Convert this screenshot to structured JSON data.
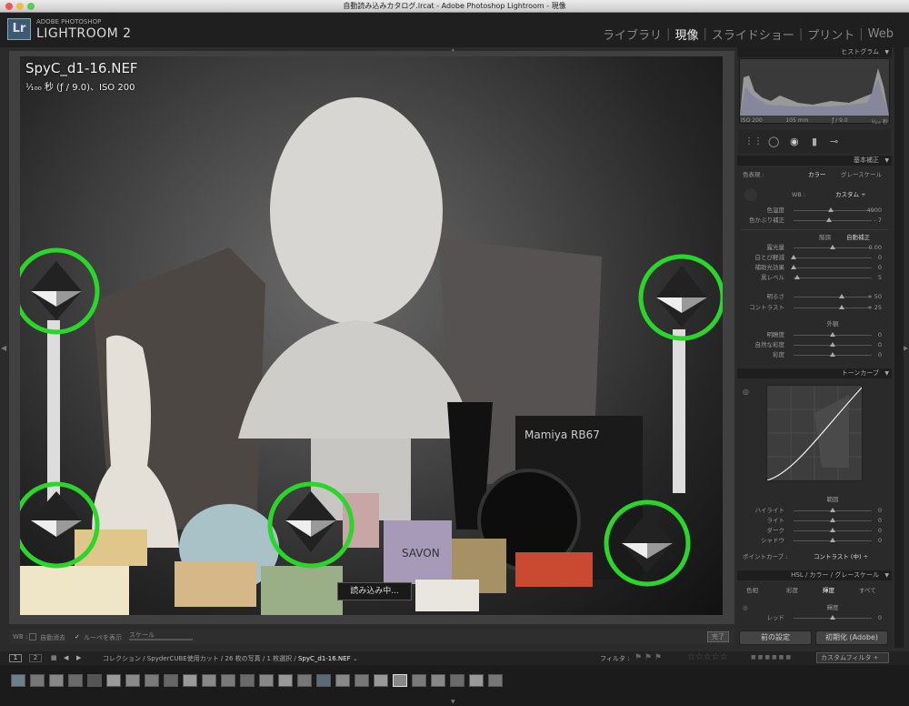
{
  "window": {
    "title": "自動読み込みカタログ.lrcat - Adobe Photoshop Lightroom - 現像"
  },
  "brand": {
    "small": "ADOBE PHOTOSHOP",
    "big": "LIGHTROOM 2",
    "badge": "Lr"
  },
  "modules": [
    "ライブラリ",
    "現像",
    "スライドショー",
    "プリント",
    "Web"
  ],
  "modules_active": "現像",
  "photo": {
    "filename": "SpyC_d1-16.NEF",
    "info": "¹⁄₁₀₀ 秒 (ƒ / 9.0)、ISO 200",
    "loading": "読み込み中...",
    "camera_label": "Mamiya RB67",
    "soap_label": "SAVON"
  },
  "toolbar": {
    "wb": "WB :",
    "auto_dismiss": "自動消去",
    "show_loupe": "ルーペを表示",
    "scale": "スケール",
    "done": "完了"
  },
  "panels": {
    "histogram": "ヒストグラム",
    "hist_info": [
      "ISO 200",
      "105 mm",
      "ƒ / 9.0",
      "¹⁄₁₀₀ 秒"
    ],
    "basic": "基本補正",
    "treatment_label": "色表現 :",
    "treatment_color": "カラー",
    "treatment_gray": "グレースケール",
    "wb_label": "WB :",
    "wb_value": "カスタム ÷",
    "tone_header": "階調",
    "auto_tone": "自動補正",
    "presence_header": "外観",
    "tonecurve": "トーンカーブ",
    "region": "範囲",
    "point_curve_label": "ポイントカーブ :",
    "point_curve_value": "コントラスト (中) ÷",
    "hsl": "HSL / カラー / グレースケール",
    "hsl_tabs": [
      "色相",
      "彩度",
      "輝度",
      "すべて"
    ],
    "luminance": "輝度",
    "red": "レッド",
    "red_value": "0"
  },
  "sliders_wb": [
    {
      "label": "色温度",
      "value": "4900",
      "pos": 0.48
    },
    {
      "label": "色かぶり補正",
      "value": "- 7",
      "pos": 0.45
    }
  ],
  "sliders_tone": [
    {
      "label": "露光量",
      "value": "0.00",
      "pos": 0.5
    },
    {
      "label": "白とび軽減",
      "value": "0",
      "pos": 0.0
    },
    {
      "label": "補助光効果",
      "value": "0",
      "pos": 0.0
    },
    {
      "label": "黒レベル",
      "value": "5",
      "pos": 0.05
    },
    {
      "label": "明るさ",
      "value": "+ 50",
      "pos": 0.62
    },
    {
      "label": "コントラスト",
      "value": "+ 25",
      "pos": 0.62
    }
  ],
  "sliders_presence": [
    {
      "label": "明瞭度",
      "value": "0",
      "pos": 0.5
    },
    {
      "label": "自然な彩度",
      "value": "0",
      "pos": 0.5
    },
    {
      "label": "彩度",
      "value": "0",
      "pos": 0.5
    }
  ],
  "sliders_region": [
    {
      "label": "ハイライト",
      "value": "0",
      "pos": 0.5
    },
    {
      "label": "ライト",
      "value": "0",
      "pos": 0.5
    },
    {
      "label": "ダーク",
      "value": "0",
      "pos": 0.5
    },
    {
      "label": "シャドウ",
      "value": "0",
      "pos": 0.5
    }
  ],
  "buttons": {
    "previous": "前の設定",
    "reset": "初期化 (Adobe)"
  },
  "filmbar": {
    "pages": [
      "1",
      "2"
    ],
    "path_prefix": "コレクション / SpyderCUBE使用カット / 26 枚の写真 / 1 枚選択 / ",
    "path_file": "SpyC_d1-16.NEF",
    "chevron": "⌄",
    "filter_label": "フィルタ :",
    "custom_filter": "カスタムフィルタ ÷"
  },
  "colors": {
    "accent_circle": "#2bd62b",
    "panel": "#2a2a2a"
  }
}
